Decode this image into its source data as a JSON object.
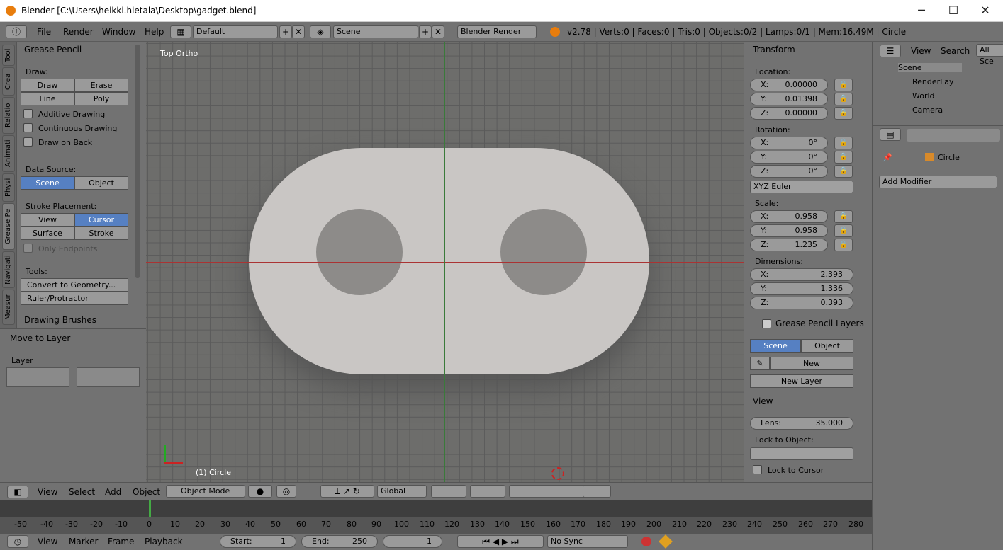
{
  "window": {
    "title": "Blender [C:\\Users\\heikki.hietala\\Desktop\\gadget.blend]",
    "minimize": "─",
    "maximize": "☐",
    "close": "✕"
  },
  "infobar": {
    "menus": [
      "File",
      "Render",
      "Window",
      "Help"
    ],
    "layout": "Default",
    "scene": "Scene",
    "engine": "Blender Render",
    "stats": "v2.78 | Verts:0 | Faces:0 | Tris:0 | Objects:0/2 | Lamps:0/1 | Mem:16.49M | Circle"
  },
  "tabs": [
    "Tool",
    "Crea",
    "Relatio",
    "Animati",
    "Physi",
    "Grease Pe",
    "Navigati",
    "Measur"
  ],
  "grease_pencil": {
    "header": "Grease Pencil",
    "draw_label": "Draw:",
    "draw": "Draw",
    "erase": "Erase",
    "line": "Line",
    "poly": "Poly",
    "additive": "Additive Drawing",
    "continuous": "Continuous Drawing",
    "on_back": "Draw on Back",
    "data_source_label": "Data Source:",
    "ds_scene": "Scene",
    "ds_object": "Object",
    "stroke_label": "Stroke Placement:",
    "sp_view": "View",
    "sp_cursor": "Cursor",
    "sp_surface": "Surface",
    "sp_stroke": "Stroke",
    "only_endpoints": "Only Endpoints",
    "tools_label": "Tools:",
    "convert": "Convert to Geometry...",
    "ruler": "Ruler/Protractor",
    "brushes": "Drawing Brushes"
  },
  "move_layer": {
    "header": "Move to Layer",
    "layer_label": "Layer"
  },
  "viewport": {
    "view_name": "Top Ortho",
    "object_name": "(1) Circle"
  },
  "transform": {
    "header": "Transform",
    "location_label": "Location:",
    "loc": [
      {
        "k": "X:",
        "v": "0.00000"
      },
      {
        "k": "Y:",
        "v": "0.01398"
      },
      {
        "k": "Z:",
        "v": "0.00000"
      }
    ],
    "rotation_label": "Rotation:",
    "rot": [
      {
        "k": "X:",
        "v": "0°"
      },
      {
        "k": "Y:",
        "v": "0°"
      },
      {
        "k": "Z:",
        "v": "0°"
      }
    ],
    "rot_mode": "XYZ Euler",
    "scale_label": "Scale:",
    "scale": [
      {
        "k": "X:",
        "v": "0.958"
      },
      {
        "k": "Y:",
        "v": "0.958"
      },
      {
        "k": "Z:",
        "v": "1.235"
      }
    ],
    "dim_label": "Dimensions:",
    "dim": [
      {
        "k": "X:",
        "v": "2.393"
      },
      {
        "k": "Y:",
        "v": "1.336"
      },
      {
        "k": "Z:",
        "v": "0.393"
      }
    ]
  },
  "gp_layers": {
    "header": "Grease Pencil Layers",
    "scene": "Scene",
    "object": "Object",
    "new": "New",
    "new_layer": "New Layer"
  },
  "view_panel": {
    "header": "View",
    "lens": "Lens:",
    "lens_val": "35.000",
    "lock_obj": "Lock to Object:",
    "lock_cursor": "Lock to Cursor"
  },
  "outliner": {
    "view": "View",
    "search": "Search",
    "all": "All Sce",
    "items": [
      "Scene",
      "RenderLay",
      "World",
      "Camera"
    ]
  },
  "properties": {
    "object": "Circle",
    "add_modifier": "Add Modifier"
  },
  "view3d_header": {
    "menus": [
      "View",
      "Select",
      "Add",
      "Object"
    ],
    "mode": "Object Mode",
    "orientation": "Global"
  },
  "timeline": {
    "ticks": [
      "-50",
      "-40",
      "-30",
      "-20",
      "-10",
      "0",
      "10",
      "20",
      "30",
      "40",
      "50",
      "60",
      "70",
      "80",
      "90",
      "100",
      "110",
      "120",
      "130",
      "140",
      "150",
      "160",
      "170",
      "180",
      "190",
      "200",
      "210",
      "220",
      "230",
      "240",
      "250",
      "260",
      "270",
      "280"
    ]
  },
  "tl_header": {
    "menus": [
      "View",
      "Marker",
      "Frame",
      "Playback"
    ],
    "start_label": "Start:",
    "start": "1",
    "end_label": "End:",
    "end": "250",
    "current": "1",
    "sync": "No Sync"
  }
}
